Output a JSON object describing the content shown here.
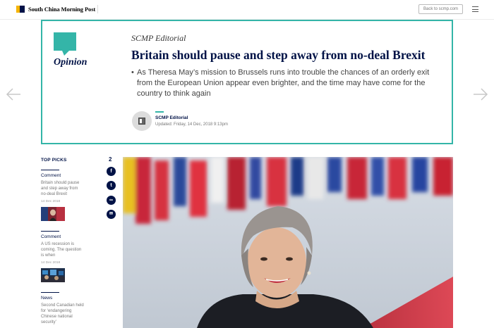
{
  "header": {
    "logo_text": "South China Morning Post",
    "back_label": "Back to scmp.com"
  },
  "icons": {
    "logo": "scmp-logo-icon",
    "menu": "hamburger-menu-icon",
    "prev": "arrow-left-icon",
    "next": "arrow-right-icon",
    "opinion": "speech-bubble-icon",
    "facebook": "facebook-icon",
    "twitter": "twitter-icon",
    "link": "link-icon",
    "email": "email-icon"
  },
  "colors": {
    "brand_navy": "#001246",
    "teal_accent": "#34b5a8",
    "logo_yellow": "#f5b400"
  },
  "opinion": {
    "section_label": "Opinion",
    "author": "SCMP Editorial",
    "title": "Britain should pause and step away from no-deal Brexit",
    "bullet": "•",
    "summary": "As Theresa May’s mission to Brussels runs into trouble the chances of an orderly exit from the European Union appear even brighter, and the time may have come for the country to think again",
    "byline_author": "SCMP Editorial",
    "updated": "Updated: Friday, 14 Dec, 2018 9:13pm"
  },
  "top_picks": {
    "title": "TOP PICKS",
    "items": [
      {
        "category": "Comment",
        "headline": "Britain should pause and step away from no-deal Brexit",
        "date": "14 Dec 2018"
      },
      {
        "category": "Comment",
        "headline": "A US recession is coming. The question is when",
        "date": "14 Dec 2018"
      },
      {
        "category": "News",
        "headline": "Second Canadian held for ‘endangering Chinese national security’",
        "date": ""
      }
    ]
  },
  "share": {
    "count": "2",
    "facebook": "f",
    "twitter": "t",
    "link": "∞",
    "email": "✉"
  }
}
